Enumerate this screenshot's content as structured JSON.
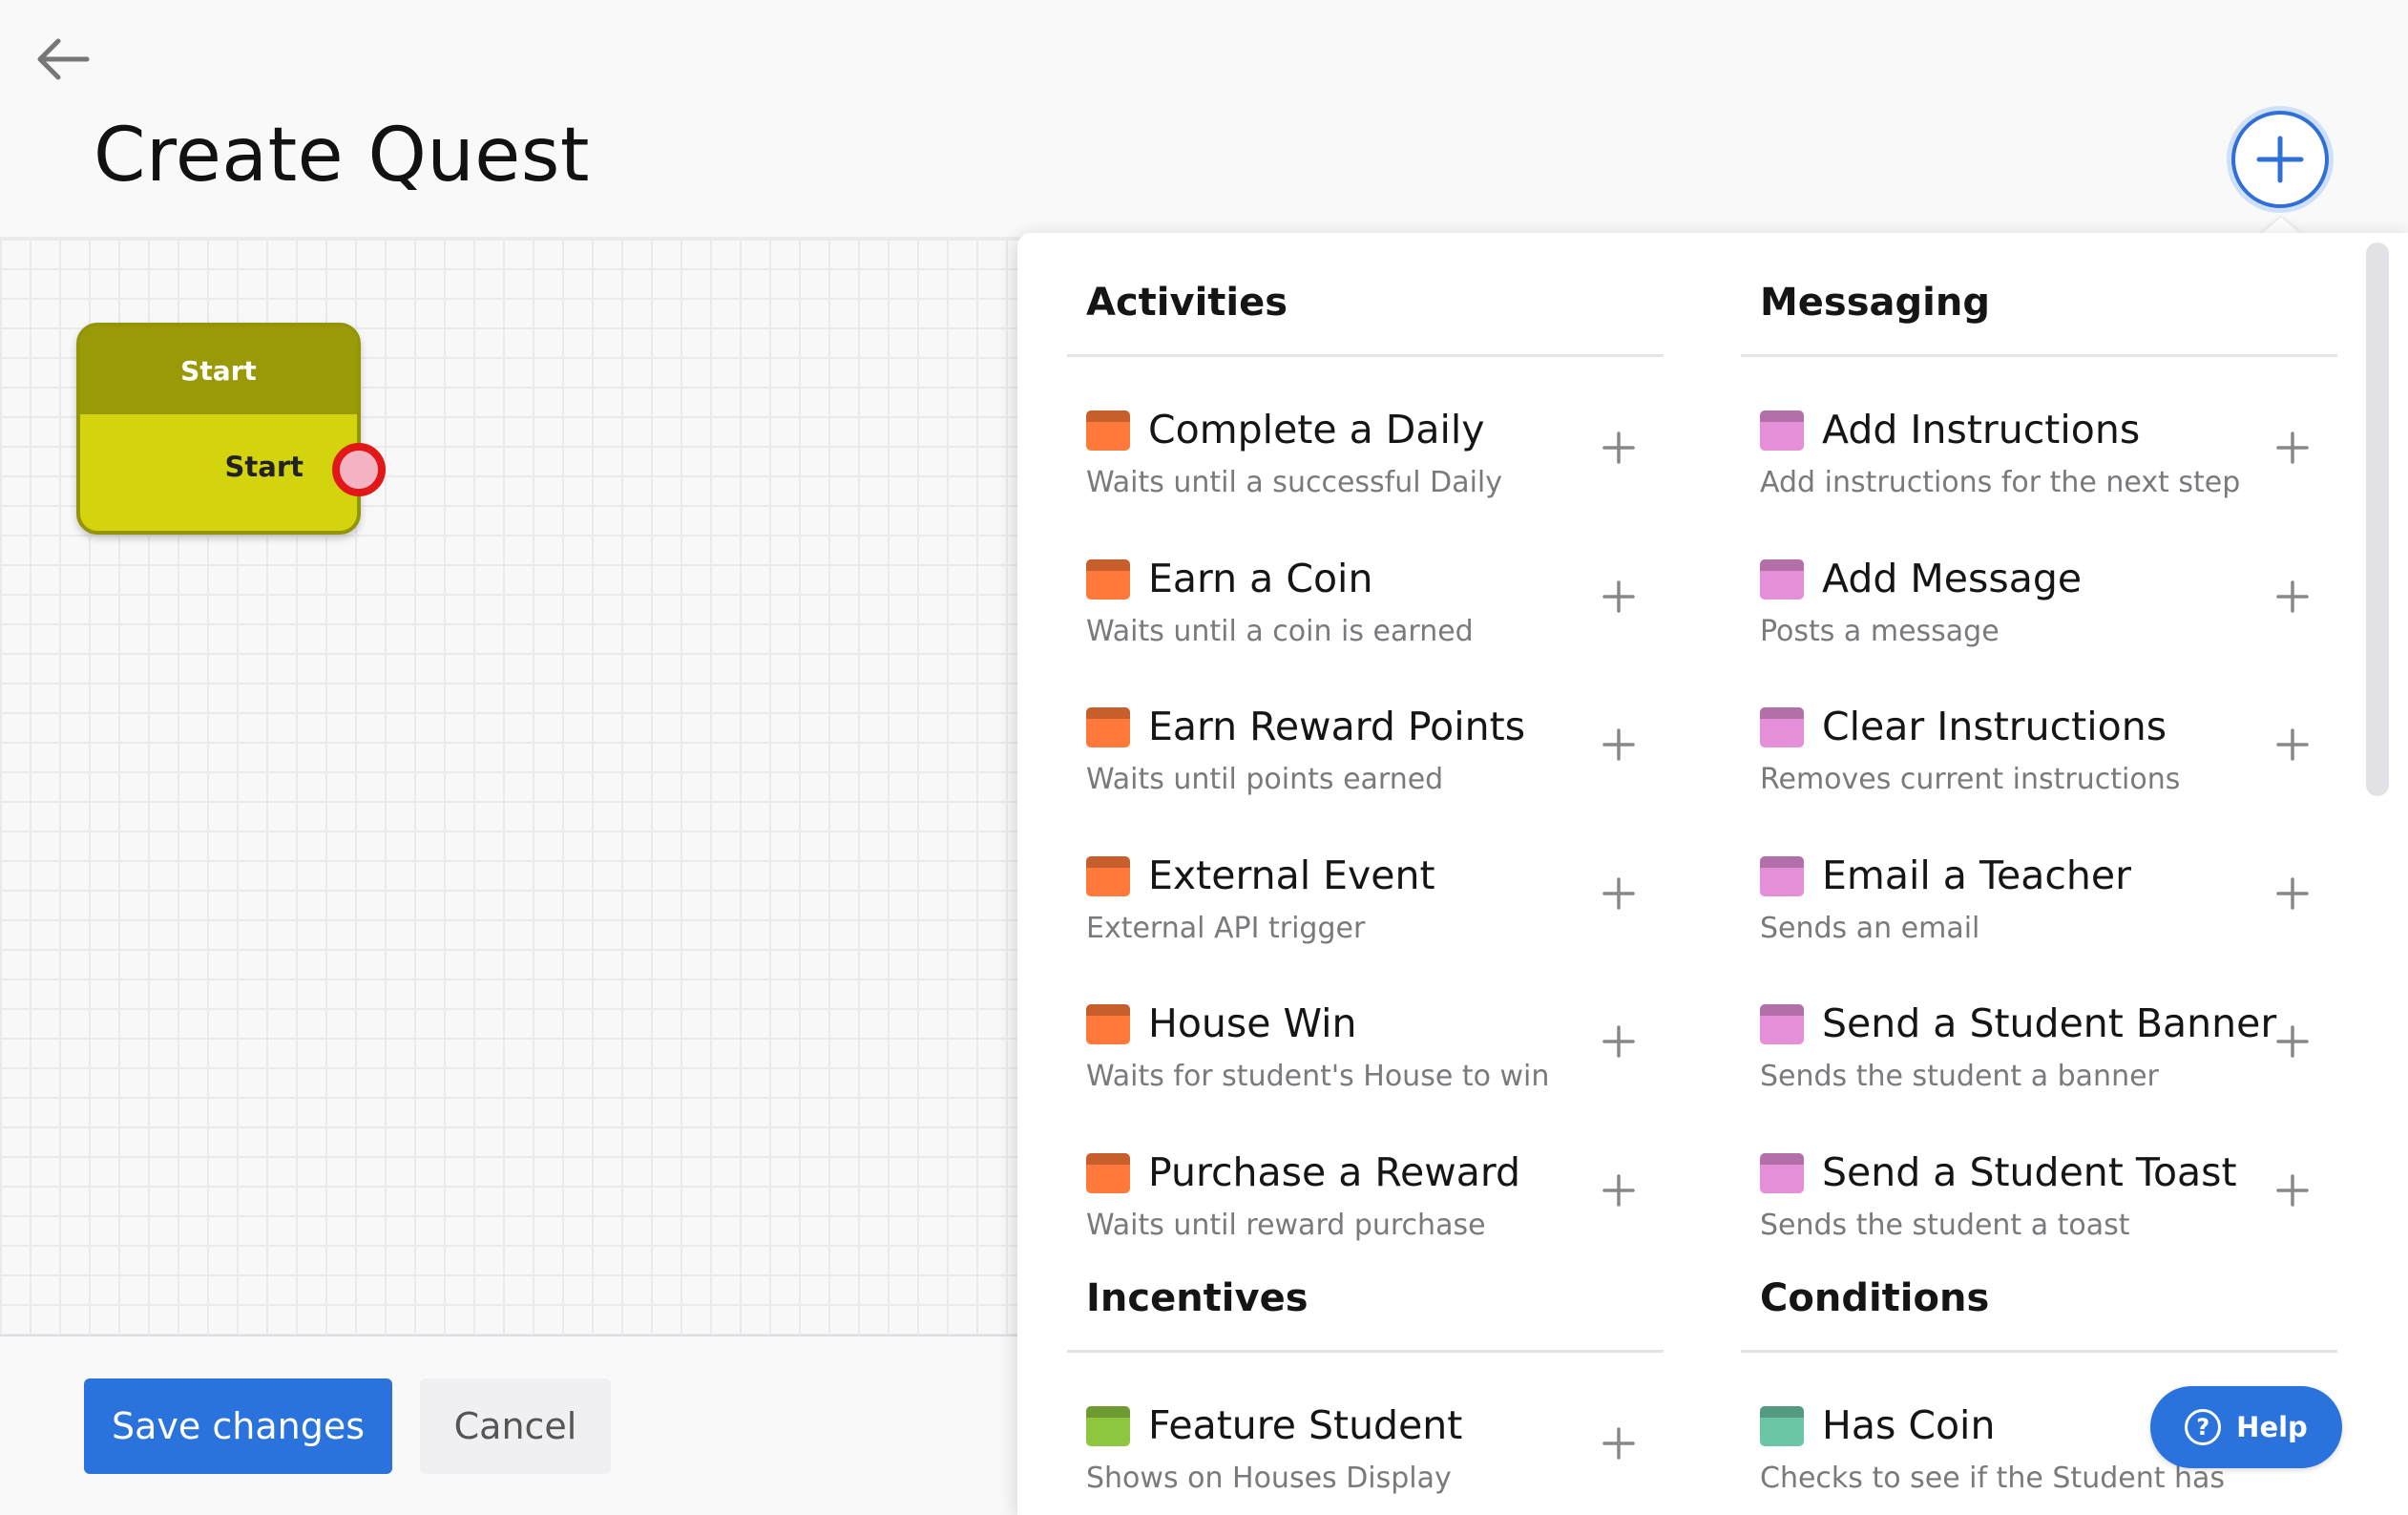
{
  "header": {
    "title": "Create Quest",
    "back_icon": "arrow-left-icon",
    "add_icon": "plus-icon"
  },
  "canvas": {
    "start_node": {
      "title": "Start",
      "output_label": "Start",
      "colors": {
        "header": "#9a9a08",
        "body": "#d4d40e",
        "port": "#e01818"
      }
    }
  },
  "footer": {
    "save_label": "Save changes",
    "cancel_label": "Cancel"
  },
  "help": {
    "label": "Help",
    "icon_glyph": "?"
  },
  "colors": {
    "primary": "#2a73dd",
    "activity": "#ff7a3a",
    "messaging": "#e58fd8",
    "incentive": "#8dc63f",
    "condition": "#6cc5a5"
  },
  "panel": {
    "col_a": [
      {
        "category": "Activities",
        "color_key": "activity",
        "items": [
          {
            "title": "Complete a Daily",
            "desc": "Waits until a successful Daily"
          },
          {
            "title": "Earn a Coin",
            "desc": "Waits until a coin is earned"
          },
          {
            "title": "Earn Reward Points",
            "desc": "Waits until points earned"
          },
          {
            "title": "External Event",
            "desc": "External API trigger"
          },
          {
            "title": "House Win",
            "desc": "Waits for student's House to win"
          },
          {
            "title": "Purchase a Reward",
            "desc": "Waits until reward purchase"
          }
        ]
      },
      {
        "category": "Incentives",
        "color_key": "incentive",
        "items": [
          {
            "title": "Feature Student",
            "desc": "Shows on Houses Display"
          }
        ]
      }
    ],
    "col_b": [
      {
        "category": "Messaging",
        "color_key": "messaging",
        "items": [
          {
            "title": "Add Instructions",
            "desc": "Add instructions for the next step"
          },
          {
            "title": "Add Message",
            "desc": "Posts a message"
          },
          {
            "title": "Clear Instructions",
            "desc": "Removes current instructions"
          },
          {
            "title": "Email a Teacher",
            "desc": "Sends an email"
          },
          {
            "title": "Send a Student Banner",
            "desc": "Sends the student a banner"
          },
          {
            "title": "Send a Student Toast",
            "desc": "Sends the student a toast"
          }
        ]
      },
      {
        "category": "Conditions",
        "color_key": "condition",
        "items": [
          {
            "title": "Has Coin",
            "desc": "Checks to see if the Student has"
          }
        ]
      }
    ]
  }
}
